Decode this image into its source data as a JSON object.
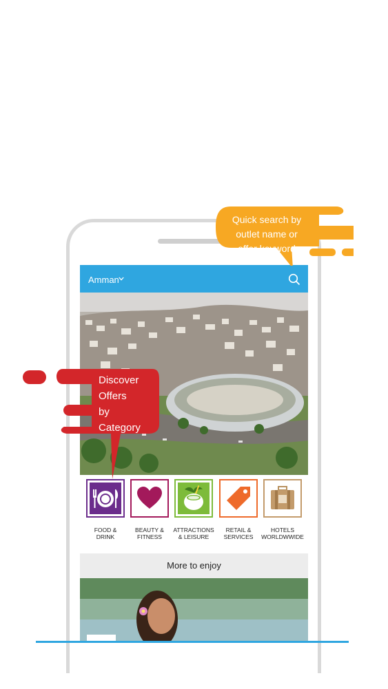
{
  "header": {
    "city": "Amman"
  },
  "callouts": {
    "search": [
      "Quick search by",
      "outlet name or",
      "offer keyword"
    ],
    "category": [
      "Discover",
      "Offers",
      "by",
      "Category"
    ]
  },
  "categories": [
    {
      "label": "FOOD &\nDRINK",
      "color": "#6b2d8c",
      "icon": "plate-cutlery-icon"
    },
    {
      "label": "BEAUTY &\nFITNESS",
      "color": "#a3195b",
      "icon": "heart-icon"
    },
    {
      "label": "ATTRACTIONS\n& LEISURE",
      "color": "#7dbb3a",
      "icon": "coconut-drink-icon"
    },
    {
      "label": "RETAIL &\nSERVICES",
      "color": "#ee6a2a",
      "icon": "price-tag-icon"
    },
    {
      "label": "HOTELS\nWORLDWWIDE",
      "color": "#c39b6b",
      "icon": "suitcase-icon"
    }
  ],
  "more_label": "More to enjoy",
  "colors": {
    "accent": "#2fa6e0",
    "orange": "#f7a823",
    "red": "#d3262a"
  }
}
